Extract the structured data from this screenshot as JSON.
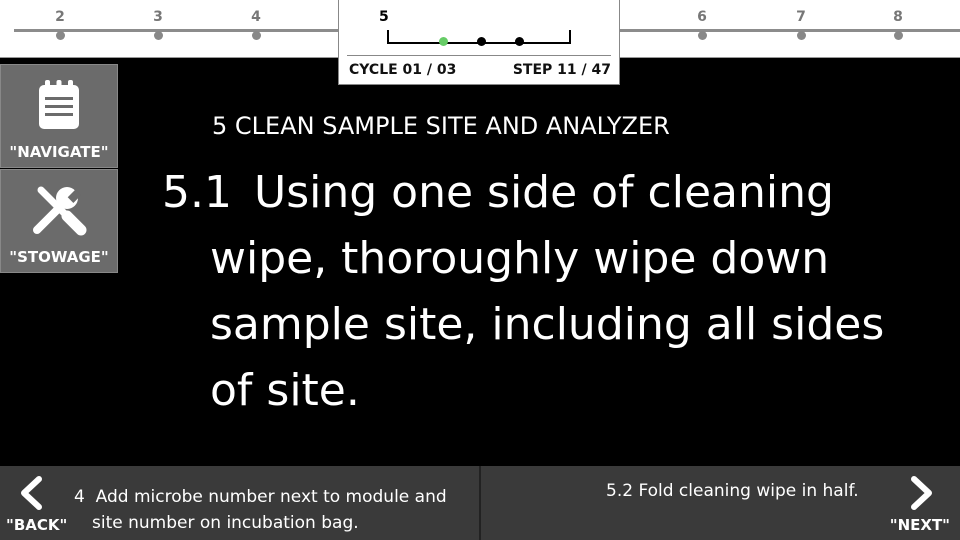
{
  "timeline": {
    "steps": [
      "2",
      "3",
      "4",
      "5",
      "6",
      "7",
      "8"
    ],
    "current_step": "5",
    "substep_count": 3,
    "active_substep": 1,
    "cycle": "CYCLE 01 / 03",
    "step_progress": "STEP 11 / 47",
    "colors": {
      "active_dot": "#66cc66",
      "inactive_dot": "#888888",
      "track": "#8c8c8c"
    }
  },
  "sidebar": {
    "navigate_label": "\"NAVIGATE\"",
    "navigate_icon": "clipboard-icon",
    "stowage_label": "\"STOWAGE\"",
    "stowage_icon": "tools-icon"
  },
  "main": {
    "section_heading": "5  CLEAN SAMPLE SITE AND ANALYZER",
    "step_number": "5.1",
    "step_text": "Using one side of cleaning wipe, thoroughly wipe down sample site, including all sides of site."
  },
  "bottom": {
    "back_label": "\"BACK\"",
    "prev_number": "4",
    "prev_line1": "Add microbe number next to module and",
    "prev_line2": "site number on incubation bag.",
    "next_label": "\"NEXT\"",
    "next_text": "5.2  Fold cleaning wipe in half."
  }
}
